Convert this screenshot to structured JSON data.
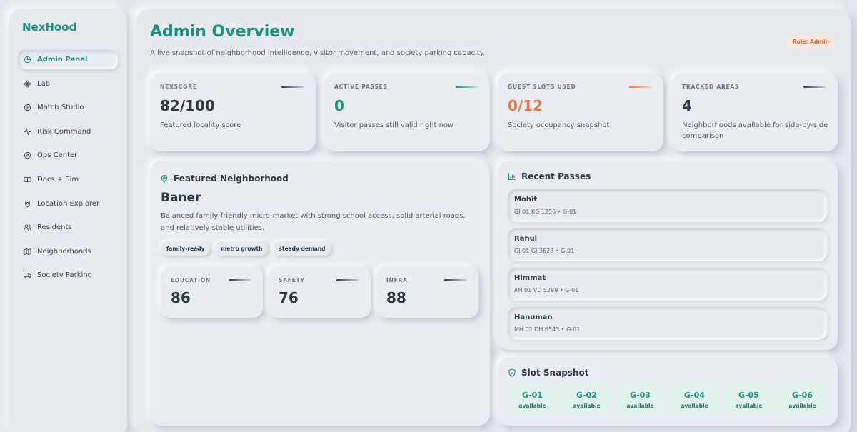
{
  "app": {
    "brand": "NexHood"
  },
  "sidebar": {
    "items": [
      {
        "label": "Admin Panel",
        "icon": "pie-chart-icon",
        "active": true
      },
      {
        "label": "Lab",
        "icon": "atom-icon"
      },
      {
        "label": "Match Studio",
        "icon": "target-icon"
      },
      {
        "label": "Risk Command",
        "icon": "activity-icon"
      },
      {
        "label": "Ops Center",
        "icon": "compass-icon"
      },
      {
        "label": "Docs + Sim",
        "icon": "book-icon"
      },
      {
        "label": "Location Explorer",
        "icon": "map-pin-icon"
      },
      {
        "label": "Residents",
        "icon": "users-icon"
      },
      {
        "label": "Neighborhoods",
        "icon": "map-icon"
      },
      {
        "label": "Society Parking",
        "icon": "truck-icon"
      }
    ]
  },
  "header": {
    "title": "Admin Overview",
    "subtitle": "A live snapshot of neighborhood intelligence, visitor movement, and society parking capacity.",
    "role_badge": "Role: Admin"
  },
  "stats": [
    {
      "label": "NEXSCORE",
      "value": "82/100",
      "desc": "Featured locality score",
      "accent": "#2b3a49"
    },
    {
      "label": "ACTIVE PASSES",
      "value": "0",
      "desc": "Visitor passes still valid right now",
      "accent": "#1f8f7f"
    },
    {
      "label": "GUEST SLOTS USED",
      "value": "0/12",
      "desc": "Society occupancy snapshot",
      "accent": "#e07a4b"
    },
    {
      "label": "TRACKED AREAS",
      "value": "4",
      "desc": "Neighborhoods available for side-by-side comparison",
      "accent": "#2b3a49"
    }
  ],
  "featured": {
    "section_title": "Featured Neighborhood",
    "name": "Baner",
    "description": "Balanced family-friendly micro-market with strong school access, solid arterial roads, and relatively stable utilities.",
    "tags": [
      "family-ready",
      "metro growth",
      "steady demand"
    ],
    "scores": [
      {
        "label": "EDUCATION",
        "value": "86"
      },
      {
        "label": "SAFETY",
        "value": "76"
      },
      {
        "label": "INFRA",
        "value": "88"
      }
    ]
  },
  "recent_passes": {
    "section_title": "Recent Passes",
    "items": [
      {
        "name": "Mohit",
        "meta": "GJ 01 KG 1256 • G-01"
      },
      {
        "name": "Rahul",
        "meta": "GJ 01 GJ 3628 • G-01"
      },
      {
        "name": "Himmat",
        "meta": "AH 01 VD 5289 • G-01"
      },
      {
        "name": "Hanuman",
        "meta": "MH 02 DH 6543 • G-01"
      }
    ]
  },
  "slot_snapshot": {
    "section_title": "Slot Snapshot",
    "slots": [
      {
        "id": "G-01",
        "status": "available"
      },
      {
        "id": "G-02",
        "status": "available"
      },
      {
        "id": "G-03",
        "status": "available"
      },
      {
        "id": "G-04",
        "status": "available"
      },
      {
        "id": "G-05",
        "status": "available"
      },
      {
        "id": "G-06",
        "status": "available"
      }
    ]
  },
  "colors": {
    "brand": "#1f8f7f",
    "accent_orange": "#e07a4b",
    "surface": "#e9ecf0"
  }
}
